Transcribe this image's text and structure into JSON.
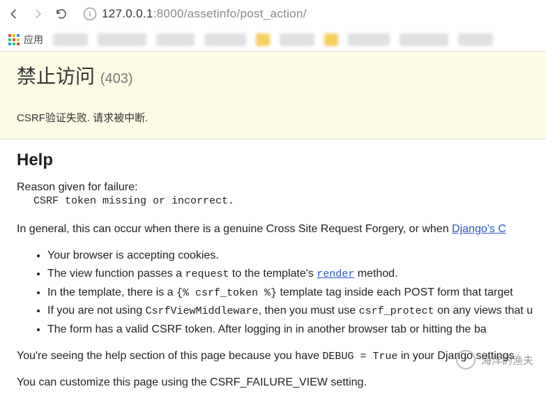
{
  "browser": {
    "url_host": "127.0.0.1",
    "url_port": ":8000",
    "url_path": "/assetinfo/post_action/"
  },
  "bookmarks": {
    "apps_label": "应用"
  },
  "error": {
    "title": "禁止访问",
    "code": "(403)",
    "message": "CSRF验证失败. 请求被中断."
  },
  "help": {
    "title": "Help",
    "reason_label": "Reason given for failure:",
    "reason_code": "CSRF token missing or incorrect.",
    "intro_pre": "In general, this can occur when there is a genuine Cross Site Request Forgery, or when ",
    "intro_link": "Django's C",
    "bullets": {
      "b1": "Your browser is accepting cookies.",
      "b2_pre": "The view function passes a ",
      "b2_code": "request",
      "b2_mid": " to the template's ",
      "b2_link": "render",
      "b2_post": " method.",
      "b3_pre": "In the template, there is a ",
      "b3_code": "{% csrf_token %}",
      "b3_post": " template tag inside each POST form that target",
      "b4_pre": "If you are not using ",
      "b4_code1": "CsrfViewMiddleware",
      "b4_mid": ", then you must use ",
      "b4_code2": "csrf_protect",
      "b4_post": " on any views that u",
      "b5": "The form has a valid CSRF token. After logging in in another browser tab or hitting the ba"
    },
    "debug_pre": "You're seeing the help section of this page because you have ",
    "debug_code": "DEBUG = True",
    "debug_post": " in your Django settings",
    "customize": "You can customize this page using the CSRF_FAILURE_VIEW setting."
  },
  "watermark": {
    "text": "海洋的渔夫"
  }
}
